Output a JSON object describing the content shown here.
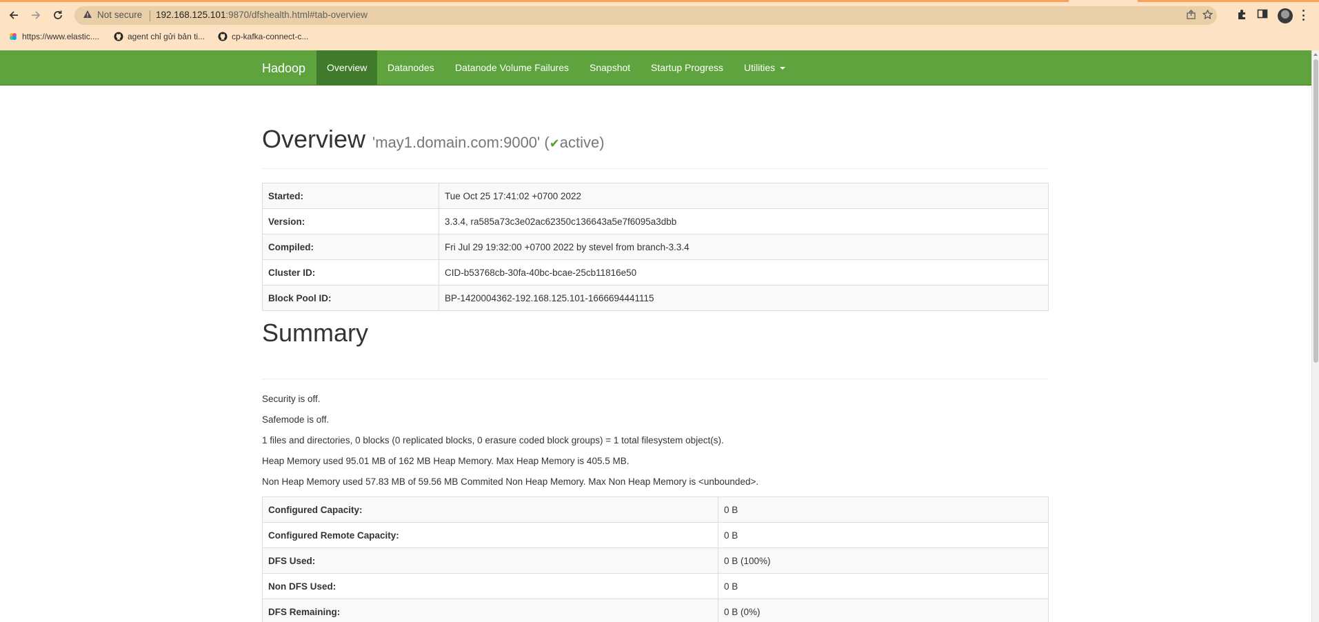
{
  "browser": {
    "security": "Not secure",
    "url_host": "192.168.125.101",
    "url_rest": ":9870/dfshealth.html#tab-overview",
    "bookmarks": [
      {
        "label": "https://www.elastic...."
      },
      {
        "label": "agent chỉ gửi bản ti..."
      },
      {
        "label": "cp-kafka-connect-c..."
      }
    ]
  },
  "navbar": {
    "brand": "Hadoop",
    "items": [
      {
        "label": "Overview",
        "active": true
      },
      {
        "label": "Datanodes"
      },
      {
        "label": "Datanode Volume Failures"
      },
      {
        "label": "Snapshot"
      },
      {
        "label": "Startup Progress"
      },
      {
        "label": "Utilities"
      }
    ]
  },
  "overview": {
    "title": "Overview",
    "host": "'may1.domain.com:9000'",
    "paren_open": "(",
    "status": "active",
    "paren_close": ")",
    "rows": [
      {
        "key": "Started:",
        "value": "Tue Oct 25 17:41:02 +0700 2022"
      },
      {
        "key": "Version:",
        "value": "3.3.4, ra585a73c3e02ac62350c136643a5e7f6095a3dbb"
      },
      {
        "key": "Compiled:",
        "value": "Fri Jul 29 19:32:00 +0700 2022 by stevel from branch-3.3.4"
      },
      {
        "key": "Cluster ID:",
        "value": "CID-b53768cb-30fa-40bc-bcae-25cb11816e50"
      },
      {
        "key": "Block Pool ID:",
        "value": "BP-1420004362-192.168.125.101-1666694441115"
      }
    ]
  },
  "summary": {
    "title": "Summary",
    "lines": [
      "Security is off.",
      "Safemode is off.",
      "1 files and directories, 0 blocks (0 replicated blocks, 0 erasure coded block groups) = 1 total filesystem object(s).",
      "Heap Memory used 95.01 MB of 162 MB Heap Memory. Max Heap Memory is 405.5 MB.",
      "Non Heap Memory used 57.83 MB of 59.56 MB Commited Non Heap Memory. Max Non Heap Memory is <unbounded>."
    ],
    "rows": [
      {
        "key": "Configured Capacity:",
        "value": "0 B"
      },
      {
        "key": "Configured Remote Capacity:",
        "value": "0 B"
      },
      {
        "key": "DFS Used:",
        "value": "0 B (100%)"
      },
      {
        "key": "Non DFS Used:",
        "value": "0 B"
      },
      {
        "key": "DFS Remaining:",
        "value": "0 B (0%)"
      }
    ]
  }
}
